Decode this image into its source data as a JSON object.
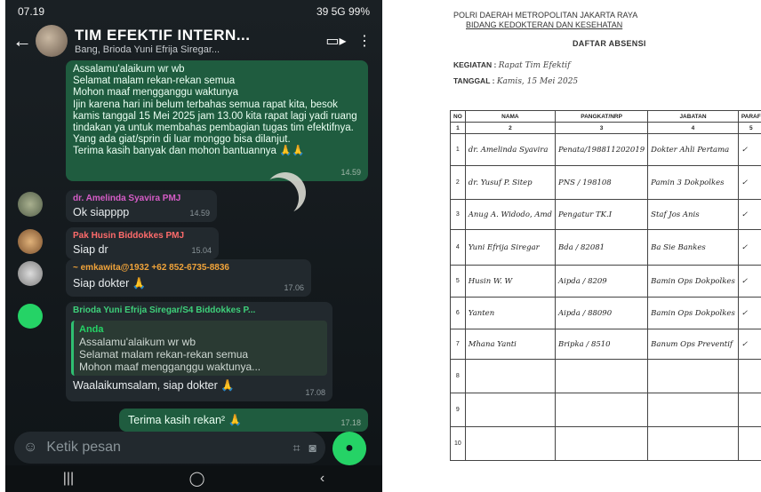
{
  "phone": {
    "status": {
      "time": "07.19",
      "right": "39 5G 99%"
    },
    "header": {
      "title": "TIM EFEKTIF INTERN...",
      "subtitle": "Bang, Brioda Yuni Efrija Siregar..."
    },
    "messages": [
      {
        "direction": "out",
        "text": "Assalamu'alaikum wr wb\nSelamat malam rekan-rekan semua\nMohon maaf mengganggu waktunya\nIjin karena hari ini belum terbahas semua rapat kita, besok kamis tanggal 15 Mei 2025 jam 13.00 kita rapat lagi yadi ruang tindakan ya untuk membahas pembagian tugas tim efektifnya. Yang ada giat/sprin di luar monggo bisa dilanjut.\nTerima kasih banyak dan mohon bantuannya 🙏🙏",
        "time": "14.59"
      },
      {
        "direction": "in",
        "sender": "dr. Amelinda Syavira PMJ",
        "text": "Ok siapppp",
        "time": "14.59"
      },
      {
        "direction": "in",
        "sender": "Pak Husin Biddokkes PMJ",
        "text": "Siap dr",
        "time": "15.04"
      },
      {
        "direction": "in",
        "sender": "~ emkawita@1932  +62 852-6735-8836",
        "text": "Siap dokter 🙏",
        "time": "17.06"
      },
      {
        "direction": "in",
        "sender": "Brioda Yuni Efrija Siregar/S4 Biddokkes P...",
        "quote_name": "Anda",
        "quote_text": "Assalamu'alaikum wr wb\nSelamat malam rekan-rekan semua\nMohon maaf mengganggu waktunya...",
        "text": "Waalaikumsalam, siap dokter 🙏",
        "time": "17.08"
      },
      {
        "direction": "out",
        "text": "Terima kasih rekan² 🙏",
        "time": "17.18"
      }
    ],
    "input_placeholder": "Ketik pesan"
  },
  "document": {
    "header_line1": "POLRI DAERAH METROPOLITAN JAKARTA RAYA",
    "header_line2": "BIDANG KEDOKTERAN DAN KESEHATAN",
    "title": "DAFTAR ABSENSI",
    "kegiatan_label": "KEGIATAN  :",
    "kegiatan_value": "Rapat Tim Efektif",
    "tanggal_label": "TANGGAL  :",
    "tanggal_value": "Kamis, 15 Mei 2025",
    "columns": [
      "NO",
      "NAMA",
      "PANGKAT/NRP",
      "JABATAN",
      "PARAF"
    ],
    "column_numbers": [
      "1",
      "2",
      "3",
      "4",
      "5"
    ],
    "rows": [
      {
        "no": "1",
        "nama": "dr. Amelinda Syavira",
        "pangkat": "Penata/198811202019",
        "jabatan": "Dokter Ahli Pertama",
        "paraf": "✓"
      },
      {
        "no": "2",
        "nama": "dr. Yusuf P. Sitep",
        "pangkat": "PNS / 198108",
        "jabatan": "Pamin 3 Dokpolkes",
        "paraf": "✓"
      },
      {
        "no": "3",
        "nama": "Anug A. Widodo, Amd",
        "pangkat": "Pengatur TK.I",
        "jabatan": "Staf Jos Anis",
        "paraf": "✓"
      },
      {
        "no": "4",
        "nama": "Yuni Efrija Siregar",
        "pangkat": "Bda / 82081",
        "jabatan": "Ba Sie Bankes",
        "paraf": "✓"
      },
      {
        "no": "5",
        "nama": "Husin W. W",
        "pangkat": "Aipda / 8209",
        "jabatan": "Bamin Ops Dokpolkes",
        "paraf": "✓"
      },
      {
        "no": "6",
        "nama": "Yanten",
        "pangkat": "Aipda / 88090",
        "jabatan": "Bamin Ops Dokpolkes",
        "paraf": "✓"
      },
      {
        "no": "7",
        "nama": "Mhana Yanti",
        "pangkat": "Bripka / 8510",
        "jabatan": "Banum Ops Preventif",
        "paraf": "✓"
      },
      {
        "no": "8",
        "nama": "",
        "pangkat": "",
        "jabatan": "",
        "paraf": ""
      },
      {
        "no": "9",
        "nama": "",
        "pangkat": "",
        "jabatan": "",
        "paraf": ""
      },
      {
        "no": "10",
        "nama": "",
        "pangkat": "",
        "jabatan": "",
        "paraf": ""
      }
    ]
  }
}
